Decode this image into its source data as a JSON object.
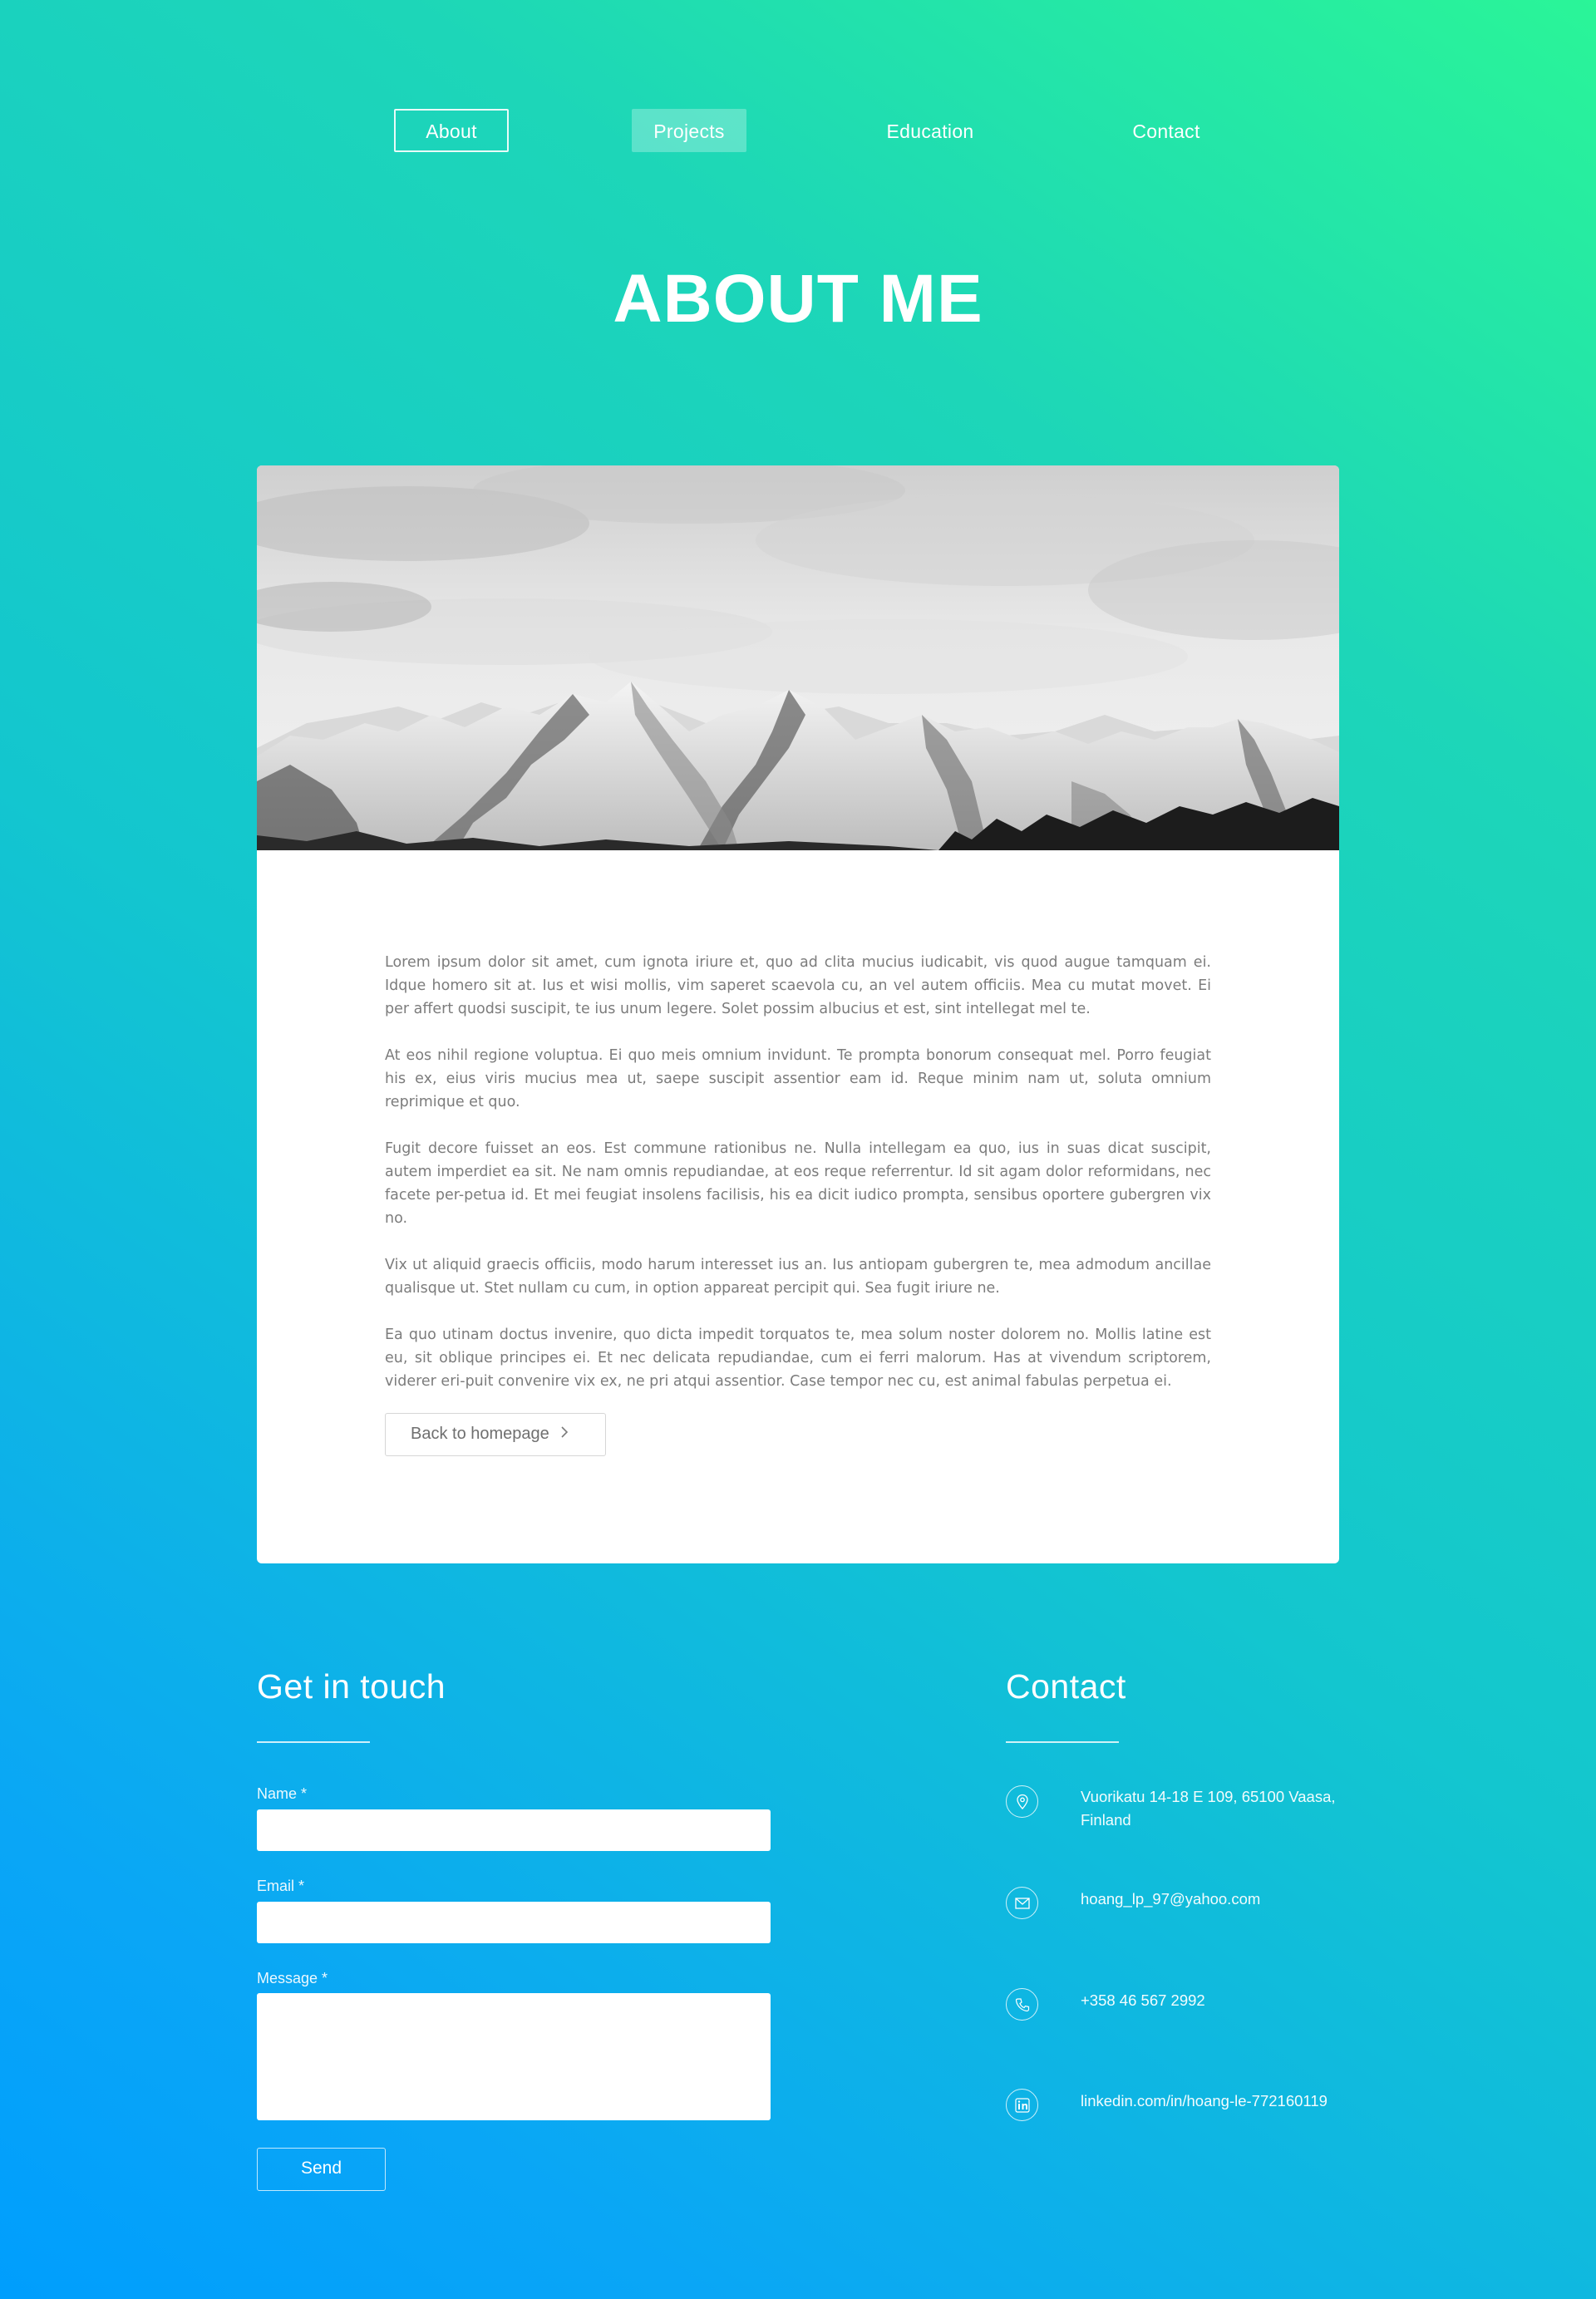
{
  "nav": {
    "items": [
      {
        "label": "About"
      },
      {
        "label": "Projects"
      },
      {
        "label": "Education"
      },
      {
        "label": "Contact"
      }
    ]
  },
  "page_title": "ABOUT ME",
  "card": {
    "hero_image": "mountain-range-photo",
    "paragraphs": [
      "Lorem ipsum dolor sit amet, cum ignota iriure et, quo ad clita mucius iudicabit, vis quod augue tamquam ei. Idque homero sit at. Ius et wisi mollis, vim saperet scaevola cu, an vel autem officiis. Mea cu mutat movet. Ei per affert quodsi suscipit, te ius unum legere. Solet possim albucius et est, sint intellegat mel te.",
      "At eos nihil regione voluptua. Ei quo meis omnium invidunt. Te prompta bonorum consequat mel. Porro feugiat his ex, eius viris mucius mea ut, saepe suscipit assentior eam id. Reque minim nam ut, soluta omnium reprimique et quo.",
      "Fugit decore fuisset an eos. Est commune rationibus ne. Nulla intellegam ea quo, ius in suas dicat suscipit, autem imperdiet ea sit. Ne nam omnis repudiandae, at eos reque referrentur. Id sit agam dolor reformidans, nec facete per-petua id. Et mei feugiat insolens facilisis, his ea dicit iudico prompta, sensibus oportere gubergren vix no.",
      "Vix ut aliquid graecis officiis, modo harum interesset ius an. Ius antiopam gubergren te, mea admodum ancillae qualisque ut. Stet nullam cu cum, in option appareat percipit qui. Sea fugit iriure ne.",
      "Ea quo utinam doctus invenire, quo dicta impedit torquatos te, mea solum noster dolorem no. Mollis latine est eu, sit oblique principes ei. Et nec delicata repudiandae, cum ei ferri malorum. Has at vivendum scriptorem, viderer eri-puit convenire vix ex, ne pri atqui assentior. Case tempor nec cu, est animal fabulas perpetua ei."
    ],
    "back_button_label": "Back to homepage"
  },
  "get_in_touch": {
    "title": "Get in touch",
    "name_label": "Name *",
    "email_label": "Email *",
    "message_label": "Message *",
    "send_label": "Send"
  },
  "contact": {
    "title": "Contact",
    "address": "Vuorikatu 14-18 E 109, 65100 Vaasa, Finland",
    "email": "hoang_lp_97@yahoo.com",
    "phone": "+358 46 567 2992",
    "linkedin": "linkedin.com/in/hoang-le-772160119",
    "icons": [
      "location-pin-icon",
      "envelope-icon",
      "phone-icon",
      "linkedin-icon"
    ]
  },
  "colors": {
    "gradient_top": "#2af598",
    "gradient_bottom": "#009efd",
    "card_background": "#ffffff",
    "body_text": "#7c7c7c"
  }
}
